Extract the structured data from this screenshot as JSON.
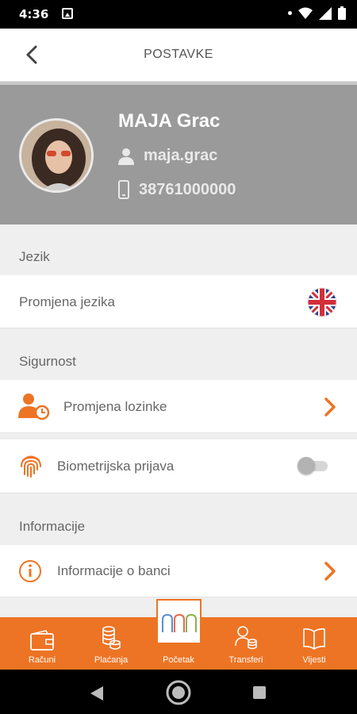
{
  "status_bar": {
    "time": "4:36"
  },
  "header": {
    "title": "POSTAVKE",
    "back_icon": "chevron-left-icon"
  },
  "profile": {
    "name": "MAJA Grac",
    "username": "maja.grac",
    "phone": "38761000000"
  },
  "sections": {
    "language": {
      "label": "Jezik",
      "item_label": "Promjena jezika",
      "flag": "uk-flag-icon"
    },
    "security": {
      "label": "Sigurnost",
      "change_password_label": "Promjena lozinke",
      "biometric_label": "Biometrijska prijava",
      "biometric_enabled": false
    },
    "information": {
      "label": "Informacije",
      "bank_info_label": "Informacije o banci"
    }
  },
  "bottom_nav": {
    "items": [
      {
        "label": "Računi",
        "icon": "wallet-icon"
      },
      {
        "label": "Plaćanja",
        "icon": "coins-icon"
      },
      {
        "label": "Početak",
        "icon": "home-logo-icon"
      },
      {
        "label": "Transferi",
        "icon": "transfer-user-icon"
      },
      {
        "label": "Vijesti",
        "icon": "book-icon"
      }
    ]
  },
  "colors": {
    "accent": "#ed7424",
    "profile_bg": "#9a9a9a",
    "page_bg": "#efefef"
  }
}
